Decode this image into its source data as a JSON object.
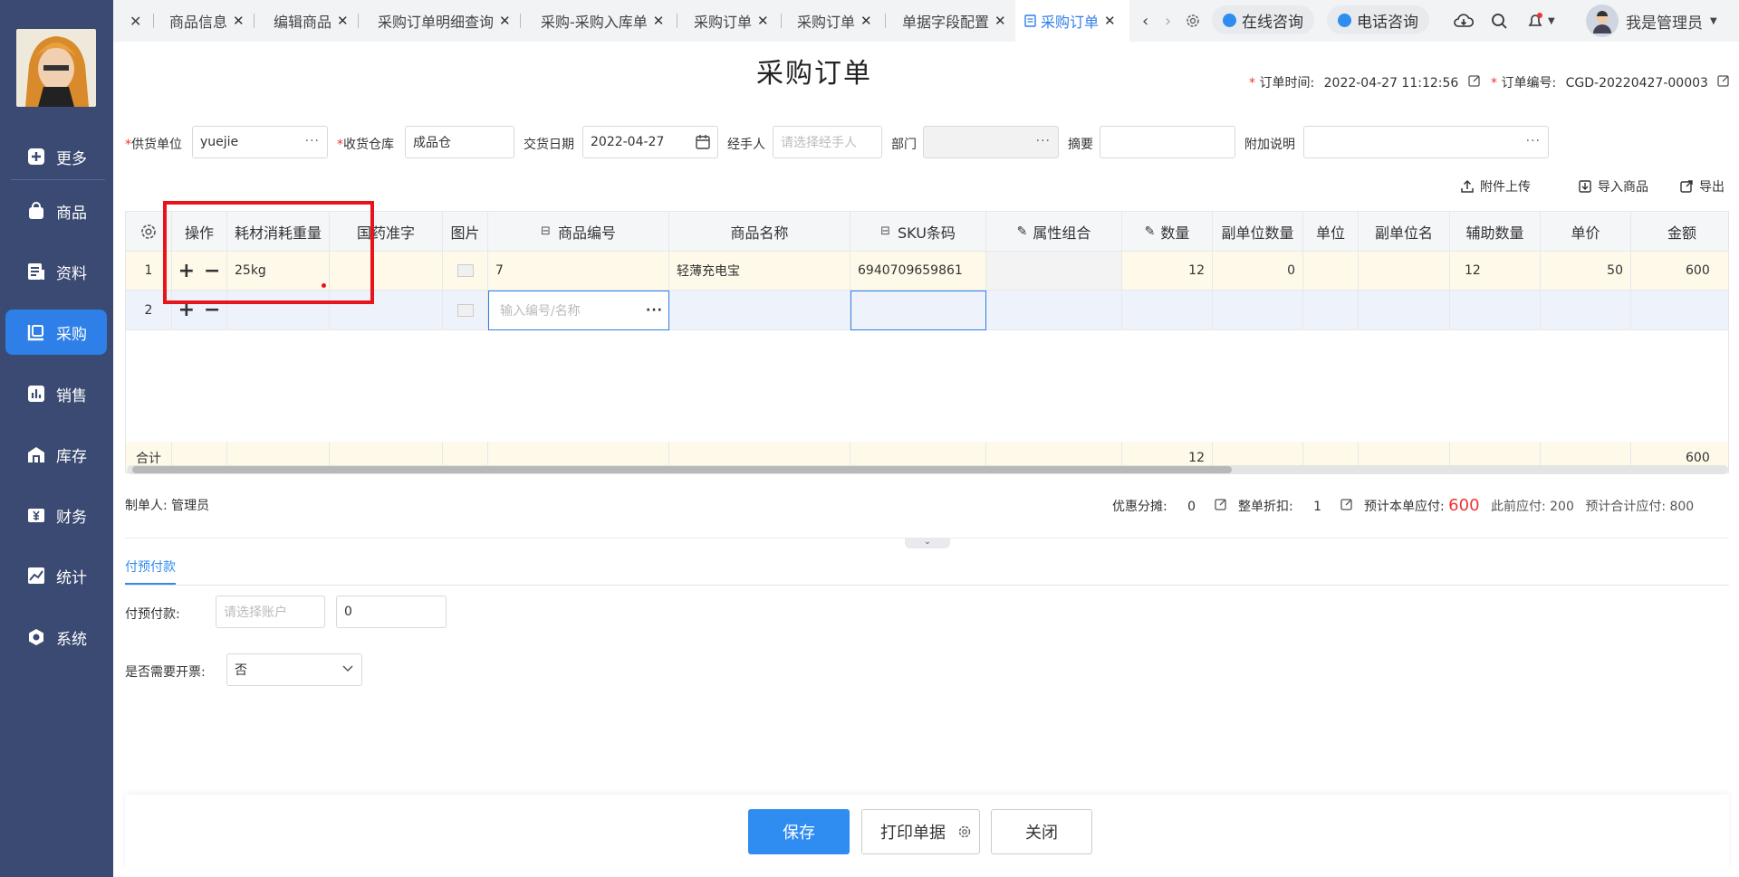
{
  "sidebar": {
    "items": [
      {
        "label": "更多",
        "icon": "plus-square-icon"
      },
      {
        "label": "商品",
        "icon": "bag-icon"
      },
      {
        "label": "资料",
        "icon": "document-icon"
      },
      {
        "label": "采购",
        "icon": "purchase-icon"
      },
      {
        "label": "销售",
        "icon": "bar-chart-icon"
      },
      {
        "label": "库存",
        "icon": "warehouse-icon"
      },
      {
        "label": "财务",
        "icon": "yuan-icon"
      },
      {
        "label": "统计",
        "icon": "trend-chart-icon"
      },
      {
        "label": "系统",
        "icon": "hexagon-gear-icon"
      }
    ]
  },
  "tabs": [
    {
      "label": "商品信息"
    },
    {
      "label": "编辑商品"
    },
    {
      "label": "采购订单明细查询"
    },
    {
      "label": "采购-采购入库单"
    },
    {
      "label": "采购订单"
    },
    {
      "label": "采购订单"
    },
    {
      "label": "单据字段配置"
    },
    {
      "label": "采购订单"
    }
  ],
  "topbar": {
    "online_consult": "在线咨询",
    "phone_consult": "电话咨询",
    "user_name": "我是管理员"
  },
  "page": {
    "title": "采购订单",
    "order_time_label": "订单时间:",
    "order_time": "2022-04-27 11:12:56",
    "order_no_label": "订单编号:",
    "order_no": "CGD-20220427-00003"
  },
  "form": {
    "supplier_label": "供货单位",
    "supplier_value": "yuejie",
    "warehouse_label": "收货仓库",
    "warehouse_value": "成品仓",
    "delivery_label": "交货日期",
    "delivery_value": "2022-04-27",
    "handler_label": "经手人",
    "handler_placeholder": "请选择经手人",
    "dept_label": "部门",
    "summary_label": "摘要",
    "extra_label": "附加说明"
  },
  "toolbar": {
    "upload": "附件上传",
    "import": "导入商品",
    "export": "导出"
  },
  "table": {
    "headers": [
      "操作",
      "耗材消耗重量",
      "国药准字",
      "图片",
      "商品编号",
      "商品名称",
      "SKU条码",
      "属性组合",
      "数量",
      "副单位数量",
      "单位",
      "副单位名",
      "辅助数量",
      "单价",
      "金额"
    ],
    "row1": {
      "index": "1",
      "weight": "25kg",
      "code": "7",
      "name": "轻薄充电宝",
      "sku": "6940709659861",
      "qty": "12",
      "sub_qty": "0",
      "aux_qty": "12",
      "price": "50",
      "amount": "600"
    },
    "row2": {
      "index": "2",
      "code_placeholder": "输入编号/名称"
    },
    "sum_label": "合计",
    "sum_qty": "12",
    "sum_amount": "600"
  },
  "summary": {
    "creator": "制单人: 管理员",
    "discount_label": "优惠分摊:",
    "discount_value": "0",
    "whole_discount_label": "整单折扣:",
    "whole_discount_value": "1",
    "payable_label": "预计本单应付:",
    "payable_value": "600",
    "prev_payable": "此前应付: 200",
    "total_payable": "预计合计应付: 800"
  },
  "payment": {
    "tab_label": "付预付款",
    "prepay_label": "付预付款:",
    "account_placeholder": "请选择账户",
    "amount_value": "0",
    "invoice_label": "是否需要开票:",
    "invoice_value": "否"
  },
  "buttons": {
    "save": "保存",
    "print": "打印单据",
    "close": "关闭"
  },
  "colors": {
    "sidebar": "#3b4a72",
    "accent": "#2f8cf0",
    "highlight": "#e8141b"
  }
}
